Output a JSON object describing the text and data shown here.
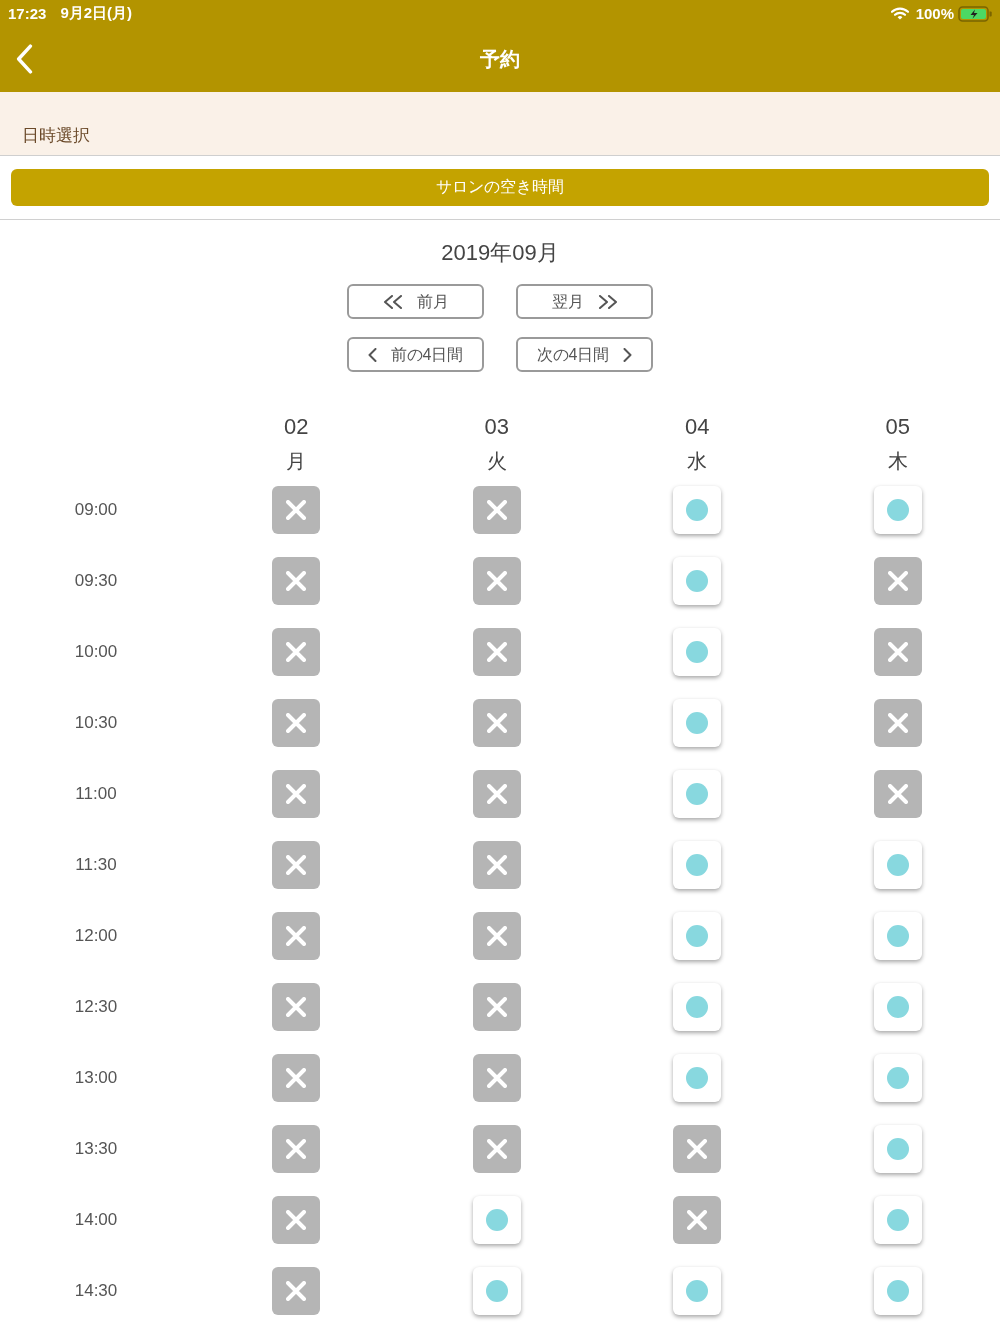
{
  "status_bar": {
    "time": "17:23",
    "date": "9月2日(月)",
    "battery": "100%"
  },
  "nav_bar": {
    "title": "予約"
  },
  "section": {
    "label": "日時選択"
  },
  "salon_button": {
    "label": "サロンの空き時間"
  },
  "calendar": {
    "month": "2019年09月",
    "month_buttons": [
      {
        "kind": "prev",
        "label": "前月"
      },
      {
        "kind": "next",
        "label": "翌月"
      }
    ],
    "range_buttons": [
      {
        "kind": "prev",
        "label": "前の4日間"
      },
      {
        "kind": "next",
        "label": "次の4日間"
      }
    ],
    "days": [
      {
        "date": "02",
        "weekday": "月"
      },
      {
        "date": "03",
        "weekday": "火"
      },
      {
        "date": "04",
        "weekday": "水"
      },
      {
        "date": "05",
        "weekday": "木"
      }
    ],
    "slots": [
      {
        "time": "09:00",
        "cells": [
          {
            "available": false
          },
          {
            "available": false
          },
          {
            "available": true
          },
          {
            "available": true
          }
        ]
      },
      {
        "time": "09:30",
        "cells": [
          {
            "available": false
          },
          {
            "available": false
          },
          {
            "available": true
          },
          {
            "available": false
          }
        ]
      },
      {
        "time": "10:00",
        "cells": [
          {
            "available": false
          },
          {
            "available": false
          },
          {
            "available": true
          },
          {
            "available": false
          }
        ]
      },
      {
        "time": "10:30",
        "cells": [
          {
            "available": false
          },
          {
            "available": false
          },
          {
            "available": true
          },
          {
            "available": false
          }
        ]
      },
      {
        "time": "11:00",
        "cells": [
          {
            "available": false
          },
          {
            "available": false
          },
          {
            "available": true
          },
          {
            "available": false
          }
        ]
      },
      {
        "time": "11:30",
        "cells": [
          {
            "available": false
          },
          {
            "available": false
          },
          {
            "available": true
          },
          {
            "available": true
          }
        ]
      },
      {
        "time": "12:00",
        "cells": [
          {
            "available": false
          },
          {
            "available": false
          },
          {
            "available": true
          },
          {
            "available": true
          }
        ]
      },
      {
        "time": "12:30",
        "cells": [
          {
            "available": false
          },
          {
            "available": false
          },
          {
            "available": true
          },
          {
            "available": true
          }
        ]
      },
      {
        "time": "13:00",
        "cells": [
          {
            "available": false
          },
          {
            "available": false
          },
          {
            "available": true
          },
          {
            "available": true
          }
        ]
      },
      {
        "time": "13:30",
        "cells": [
          {
            "available": false
          },
          {
            "available": false
          },
          {
            "available": false
          },
          {
            "available": true
          }
        ]
      },
      {
        "time": "14:00",
        "cells": [
          {
            "available": false
          },
          {
            "available": true
          },
          {
            "available": false
          },
          {
            "available": true
          }
        ]
      },
      {
        "time": "14:30",
        "cells": [
          {
            "available": false
          },
          {
            "available": true
          },
          {
            "available": true
          },
          {
            "available": true
          }
        ]
      }
    ]
  }
}
